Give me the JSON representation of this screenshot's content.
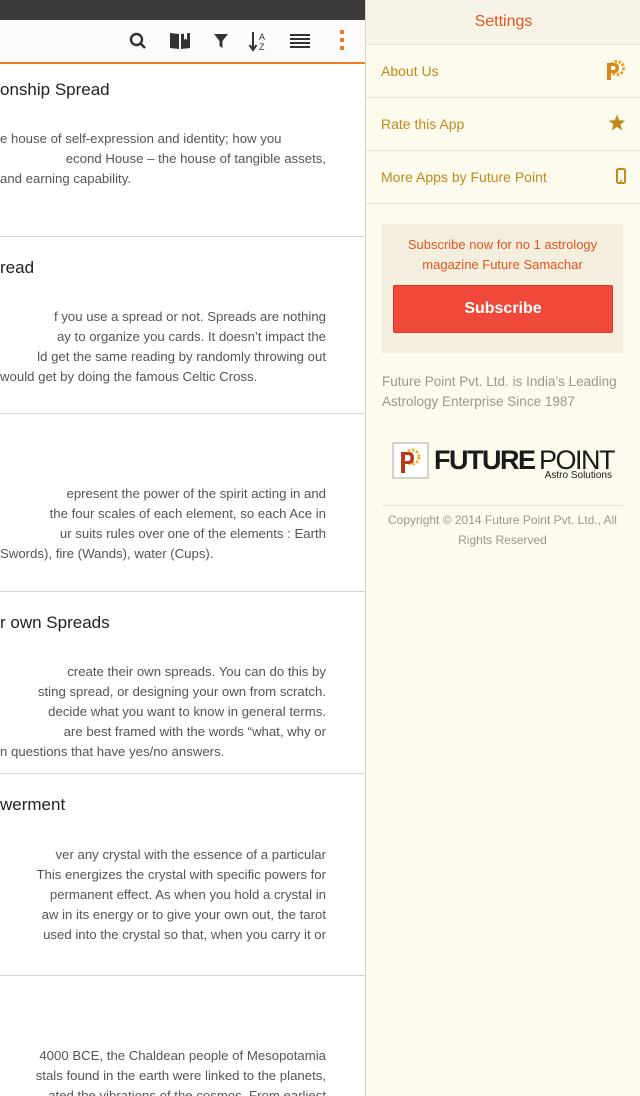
{
  "toolbar": {
    "icons": [
      "search-icon",
      "book-icon",
      "filter-icon",
      "sort-az-icon",
      "list-icon",
      "overflow-menu-icon"
    ],
    "accent": "#f07c22"
  },
  "sections": [
    {
      "title": "onship Spread",
      "lines": [
        "e house of self-expression and identity; how you",
        "econd House – the house of tangible assets,",
        "and earning capability."
      ]
    },
    {
      "title": "read",
      "lines": [
        "f you use a spread or not. Spreads are nothing",
        "ay to organize you cards. It doesn’t impact the",
        "ld get the same reading by randomly throwing out",
        "would get by doing the famous Celtic Cross."
      ]
    },
    {
      "title": "",
      "lines": [
        "epresent the power of the spirit acting in and",
        "the four scales of each element, so each Ace in",
        "ur suits rules over one of the elements : Earth",
        "Swords), fire (Wands), water (Cups)."
      ]
    },
    {
      "title": "r own Spreads",
      "lines": [
        "create their own spreads. You can do this by",
        "sting spread, or designing your own from scratch.",
        "decide what you want to know in general terms.",
        "are best framed with the words “what, why or",
        "n questions that have yes/no answers."
      ]
    },
    {
      "title": "werment",
      "lines": [
        "ver any crystal with the essence of a particular",
        "This energizes the crystal with specific powers for",
        "permanent effect. As when you hold a crystal in",
        "aw in its energy or to give your own out, the tarot",
        "used into the crystal so that, when you carry it or"
      ]
    },
    {
      "title": "",
      "lines": [
        "4000 BCE, the Chaldean people of Mesopotamia",
        "stals found in the earth were linked to the planets,",
        "ated the vibrations of the cosmos. From earliest"
      ]
    }
  ],
  "settings": {
    "title": "Settings",
    "menu": [
      {
        "label": "About Us",
        "icon": "future-point-icon"
      },
      {
        "label": "Rate this App",
        "icon": "star-icon"
      },
      {
        "label": "More Apps by Future Point",
        "icon": "phone-icon"
      }
    ],
    "subscribe_text": "Subscribe now for no 1 astrology magazine Future Samachar",
    "subscribe_label": "Subscribe",
    "about_text": "Future Point Pvt. Ltd. is India’s Leading Astrology Enterprise Since 1987",
    "logo_main_a": "FUTURE",
    "logo_main_b": "POINT",
    "logo_sub": "Astro Solutions",
    "copyright": "Copyright © 2014 Future Point Pvt. Ltd., All Rights Reserved",
    "colors": {
      "title": "#e2561f",
      "menu_text": "#c08a1d",
      "button": "#f0483a",
      "panel_bg": "#fdfbee"
    }
  }
}
